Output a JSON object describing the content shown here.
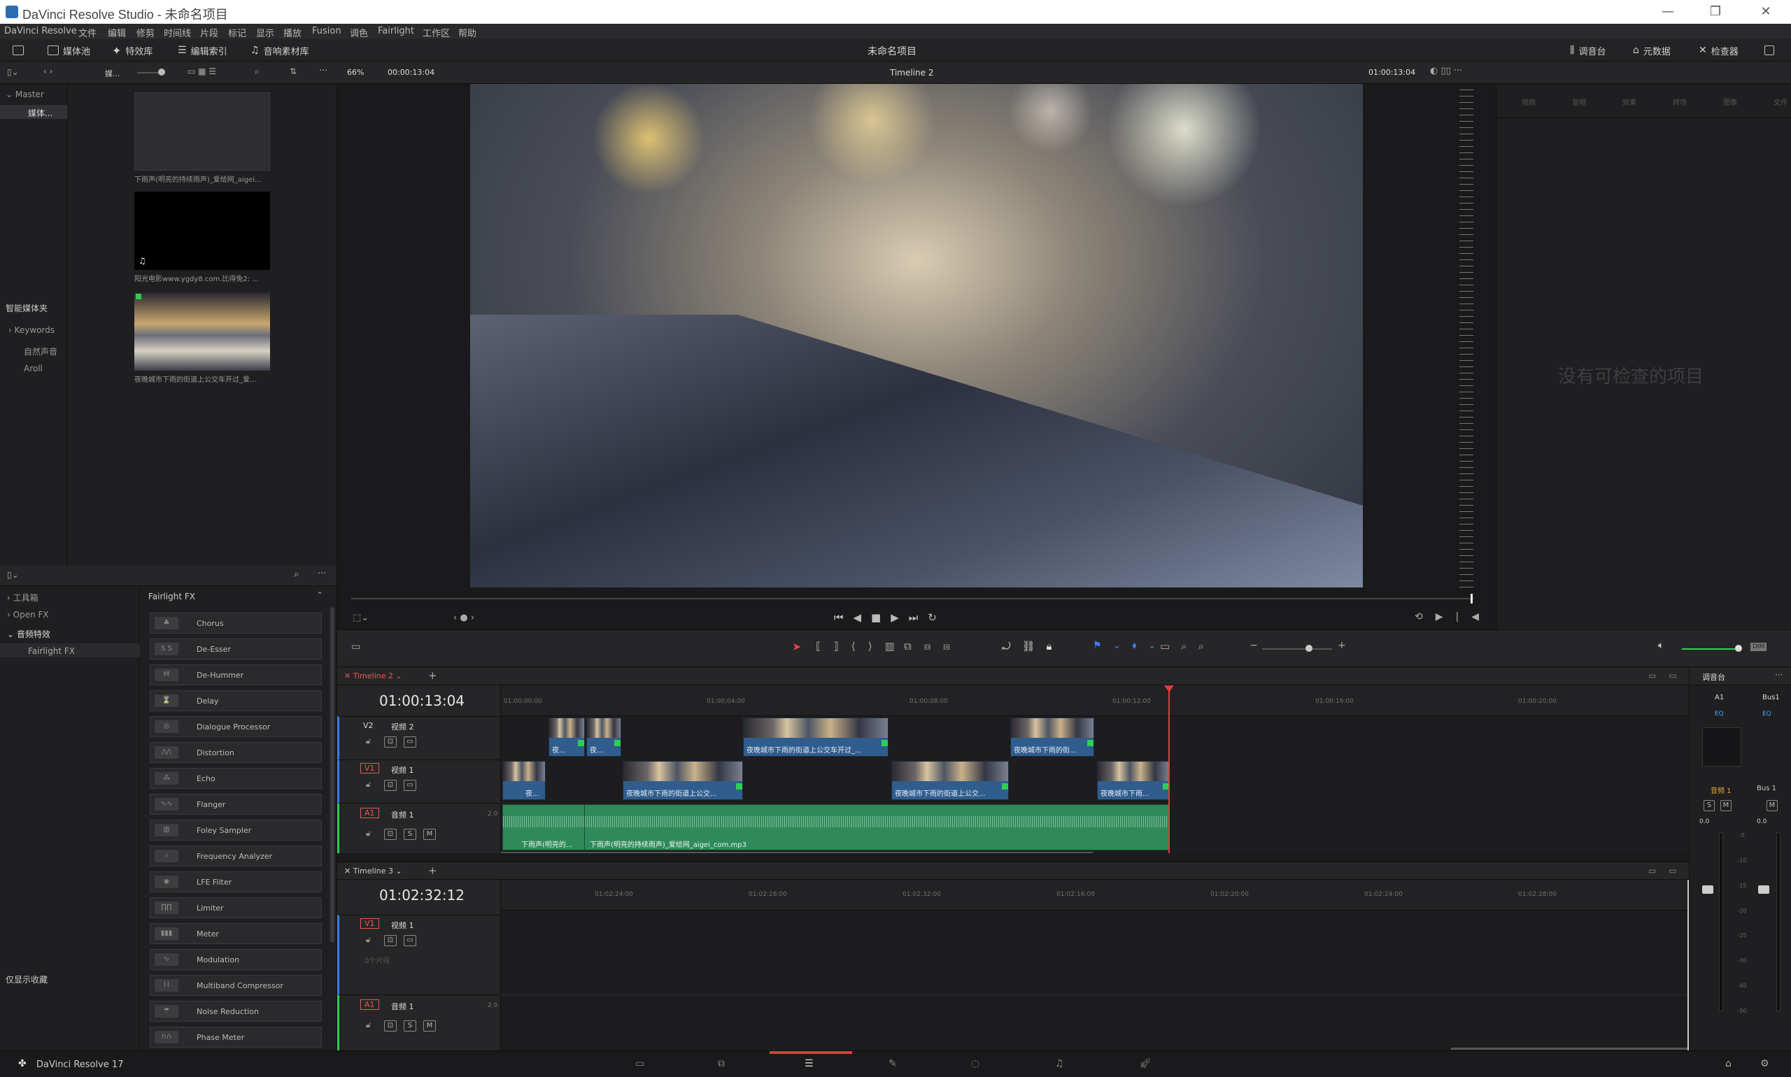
{
  "window": {
    "title": "DaVinci Resolve Studio - 未命名项目",
    "controls": [
      "—",
      "❐",
      "✕"
    ]
  },
  "menu": [
    "DaVinci Resolve",
    "文件",
    "编辑",
    "修剪",
    "时间线",
    "片段",
    "标记",
    "显示",
    "播放",
    "Fusion",
    "调色",
    "Fairlight",
    "工作区",
    "帮助"
  ],
  "toolbar": {
    "media_pool": "媒体池",
    "effects": "特效库",
    "edit_index": "编辑索引",
    "sound_library": "音响素材库",
    "project_name": "未命名项目",
    "mixer": "调音台",
    "metadata": "元数据",
    "inspector": "检查器"
  },
  "subbar": {
    "bin_short": "媒...",
    "zoom": "66%",
    "source_timecode": "00:00:13:04",
    "timeline_name": "Timeline 2",
    "record_timecode": "01:00:13:04"
  },
  "bins": {
    "master": "Master",
    "sub": "媒体...",
    "smart_bins": "智能媒体夹",
    "keywords": "Keywords",
    "items": [
      "自然声音",
      "Aroll"
    ]
  },
  "media": [
    {
      "name": "下雨声(明亮的持续雨声)_爱给网_aigei..."
    },
    {
      "name": "阳光电影www.ygdy8.com.比得兔2: ..."
    },
    {
      "name": "夜晚城市下雨的街道上公交车开过_爱..."
    }
  ],
  "fx_tree": {
    "toolbox": "工具箱",
    "openfx": "Open FX",
    "audio_fx": "音频特效",
    "fairlight_fx": "Fairlight FX",
    "favorites": "仅显示收藏"
  },
  "fx_list": {
    "header": "Fairlight FX",
    "items": [
      {
        "name": "Chorus",
        "abbr": "♣"
      },
      {
        "name": "De-Esser",
        "abbr": "S S"
      },
      {
        "name": "De-Hummer",
        "abbr": "M"
      },
      {
        "name": "Delay",
        "abbr": "⌛"
      },
      {
        "name": "Dialogue Processor",
        "abbr": "◎"
      },
      {
        "name": "Distortion",
        "abbr": "/\\/\\"
      },
      {
        "name": "Echo",
        "abbr": "⁂"
      },
      {
        "name": "Flanger",
        "abbr": "∿∿"
      },
      {
        "name": "Foley Sampler",
        "abbr": "▥"
      },
      {
        "name": "Frequency Analyzer",
        "abbr": "⌕"
      },
      {
        "name": "LFE Filter",
        "abbr": "◉"
      },
      {
        "name": "Limiter",
        "abbr": "∏∏"
      },
      {
        "name": "Meter",
        "abbr": "▮▮▮"
      },
      {
        "name": "Modulation",
        "abbr": "∿"
      },
      {
        "name": "Multiband Compressor",
        "abbr": "⌇⌇"
      },
      {
        "name": "Noise Reduction",
        "abbr": "☂"
      },
      {
        "name": "Phase Meter",
        "abbr": "∩∩"
      }
    ]
  },
  "inspector": {
    "tabs": [
      "视频",
      "音频",
      "效果",
      "转场",
      "图像",
      "文件"
    ],
    "empty": "没有可检查的项目"
  },
  "timeline2": {
    "tab": "Timeline 2",
    "timecode": "01:00:13:04",
    "ruler": [
      "01:00:00:00",
      "01:00:04:00",
      "01:00:08:00",
      "01:00:12:00",
      "01:00:16:00",
      "01:00:20:00"
    ],
    "tracks": {
      "v2": {
        "id": "V2",
        "name": "视频 2"
      },
      "v1": {
        "id": "V1",
        "name": "视频 1"
      },
      "a1": {
        "id": "A1",
        "name": "音频 1",
        "ch": "2.0"
      }
    },
    "clips_v2": [
      "夜...",
      "夜...",
      "夜晚城市下雨的街道上公交车开过_...",
      "夜晚城市下雨的街..."
    ],
    "clips_v1": [
      "夜...",
      "夜晚城市下雨的街道上公交...",
      "夜晚城市下雨的街道上公交...",
      "夜晚城市下雨..."
    ],
    "clips_a1": [
      "下雨声(明亮的...",
      "下雨声(明亮的持续雨声)_爱给网_aigei_com.mp3"
    ]
  },
  "timeline3": {
    "tab": "Timeline 3",
    "timecode": "01:02:32:12",
    "ruler": [
      "01:02:24:00",
      "01:02:28:00",
      "01:02:32:00",
      "01:02:16:00",
      "01:02:20:00",
      "01:02:24:00",
      "01:02:28:00"
    ],
    "v1": {
      "id": "V1",
      "name": "视频 1",
      "empty": "0个片段"
    },
    "a1": {
      "id": "A1",
      "name": "音频 1",
      "ch": "2.0"
    }
  },
  "mixer": {
    "title": "调音台",
    "ch1": "A1",
    "ch2": "Bus1",
    "eq": "EQ",
    "name1": "音频 1",
    "name2": "Bus 1",
    "db": [
      "0.0",
      "0.0"
    ],
    "scale": [
      "-5",
      "-10",
      "-15",
      "-20",
      "-25",
      "-30",
      "-40",
      "-50"
    ]
  },
  "status": {
    "app": "DaVinci Resolve 17"
  },
  "colors": {
    "playhead": "#e03b3b",
    "audio_clip": "#2e8b57",
    "video_clip": "#2f5d8d",
    "accent_red": "#c0392b"
  }
}
